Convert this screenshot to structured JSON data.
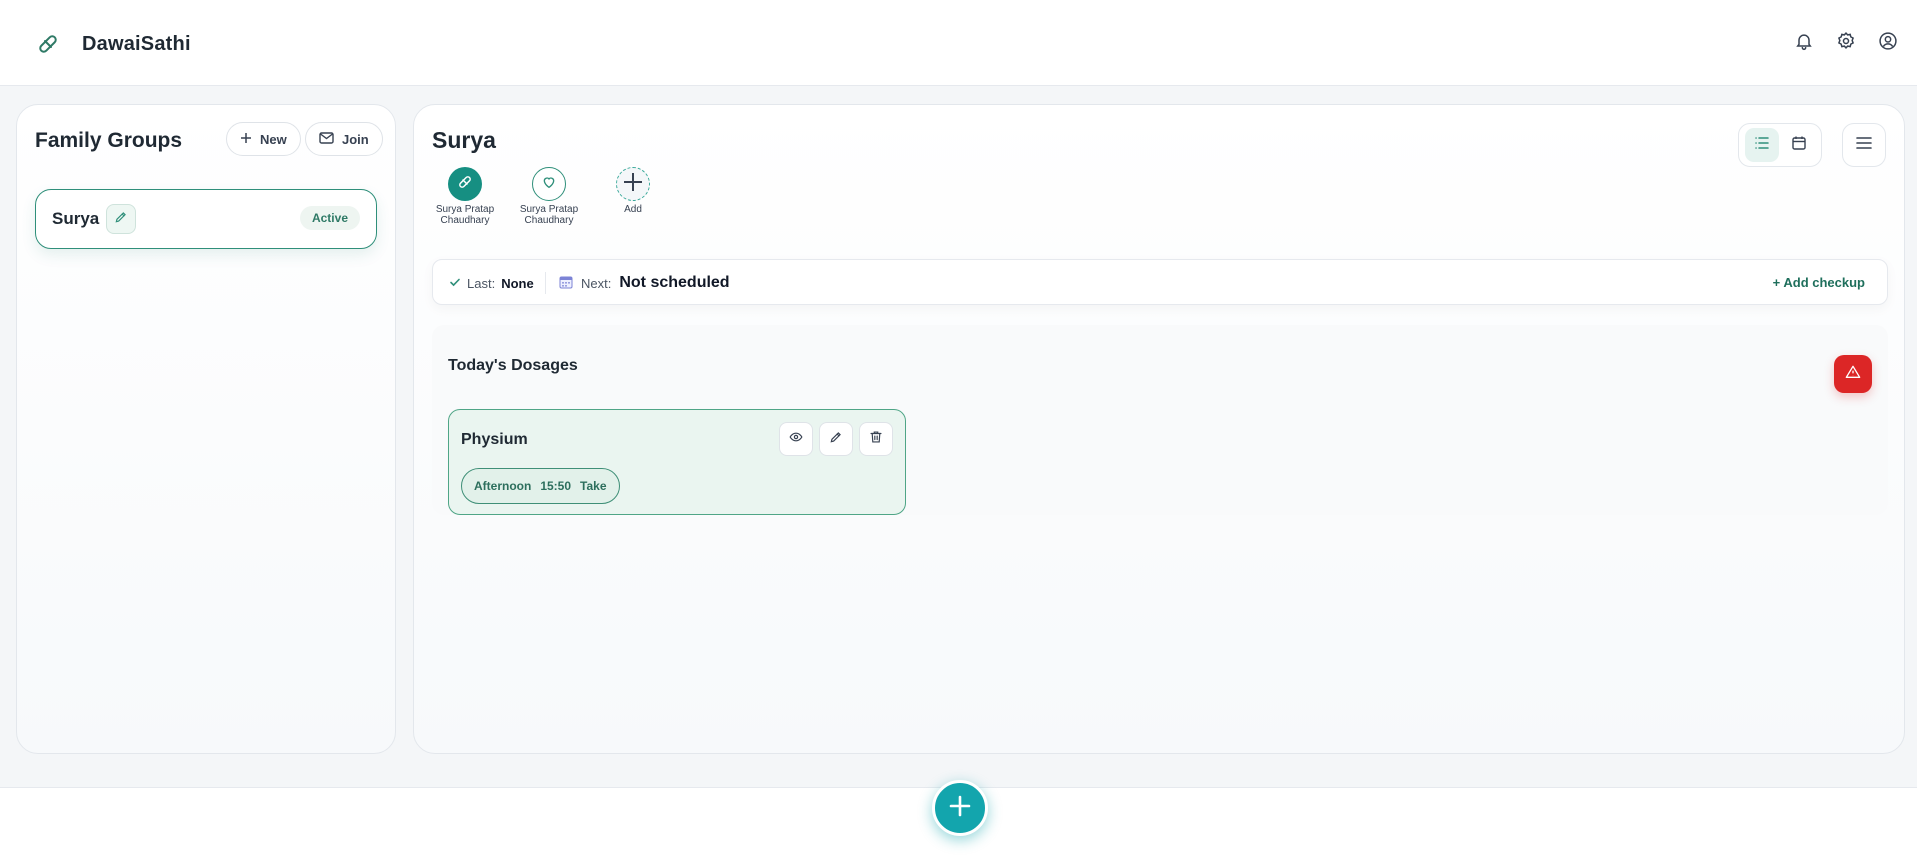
{
  "app": {
    "name": "DawaiSathi",
    "logo_icon": "pill-icon"
  },
  "header": {
    "icons": [
      "bell-icon",
      "gear-icon",
      "user-circle-icon"
    ]
  },
  "family_groups": {
    "title": "Family Groups",
    "new_label": "New",
    "join_label": "Join",
    "groups": [
      {
        "name": "Surya",
        "badge": "Active"
      }
    ]
  },
  "main": {
    "title": "Surya",
    "members": [
      {
        "label": "Surya Pratap Chaudhary",
        "icon": "pill-icon",
        "style": "filled"
      },
      {
        "label": "Surya Pratap Chaudhary",
        "icon": "heart-icon",
        "style": "outline"
      },
      {
        "label": "Add",
        "icon": "plus-icon",
        "style": "dashed"
      }
    ]
  },
  "checkup": {
    "last_label": "Last:",
    "last_value": "None",
    "next_label": "Next:",
    "next_value": "Not scheduled",
    "add_label": "+ Add checkup"
  },
  "dosages": {
    "title": "Today's Dosages",
    "items": [
      {
        "name": "Physium",
        "time_of_day": "Afternoon",
        "time": "15:50",
        "action": "Take"
      }
    ]
  },
  "colors": {
    "accent": "#168f82",
    "alert": "#dc2626",
    "fab": "#13a5ad",
    "card_bg": "#eaf5f0"
  }
}
